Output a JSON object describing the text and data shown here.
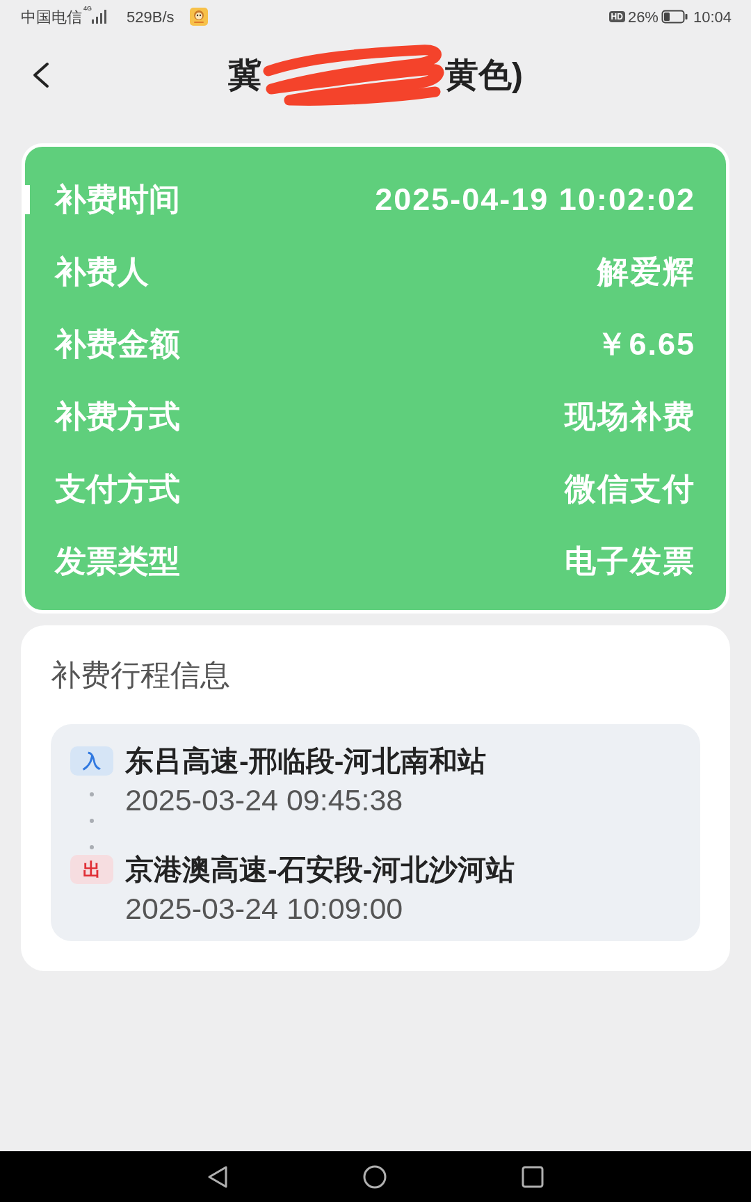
{
  "status_bar": {
    "carrier": "中国电信",
    "network_type": "4G",
    "speed": "529B/s",
    "hd_badge": "HD",
    "battery": "26%",
    "time": "10:04"
  },
  "header": {
    "title_start": "冀",
    "title_end": "黄色)"
  },
  "fee_details": [
    {
      "label": "补费时间",
      "value": "2025-04-19 10:02:02",
      "selected": true
    },
    {
      "label": "补费人",
      "value": "解爱辉",
      "selected": false
    },
    {
      "label": "补费金额",
      "value": "￥6.65",
      "selected": false
    },
    {
      "label": "补费方式",
      "value": "现场补费",
      "selected": false
    },
    {
      "label": "支付方式",
      "value": "微信支付",
      "selected": false
    },
    {
      "label": "发票类型",
      "value": "电子发票",
      "selected": false
    }
  ],
  "trip_info": {
    "title": "补费行程信息",
    "points": [
      {
        "kind": "entry",
        "tag": "入",
        "station": "东吕高速-邢临段-河北南和站",
        "time": "2025-03-24 09:45:38"
      },
      {
        "kind": "exit",
        "tag": "出",
        "station": "京港澳高速-石安段-河北沙河站",
        "time": "2025-03-24 10:09:00"
      }
    ]
  }
}
